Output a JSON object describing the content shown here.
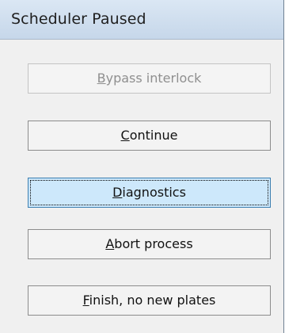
{
  "window": {
    "title": "Scheduler Paused"
  },
  "buttons": [
    {
      "mnemonic": "B",
      "rest": "ypass interlock",
      "state": "disabled"
    },
    {
      "mnemonic": "C",
      "rest": "ontinue",
      "state": "normal"
    },
    {
      "mnemonic": "D",
      "rest": "iagnostics",
      "state": "focused"
    },
    {
      "mnemonic": "A",
      "rest": "bort process",
      "state": "normal"
    },
    {
      "mnemonic": "F",
      "rest": "inish, no new plates",
      "state": "normal"
    }
  ],
  "colors": {
    "titlebar": "#cfdeee",
    "focused_button": "#cde8fb",
    "disabled_text": "#8f8f8f"
  }
}
